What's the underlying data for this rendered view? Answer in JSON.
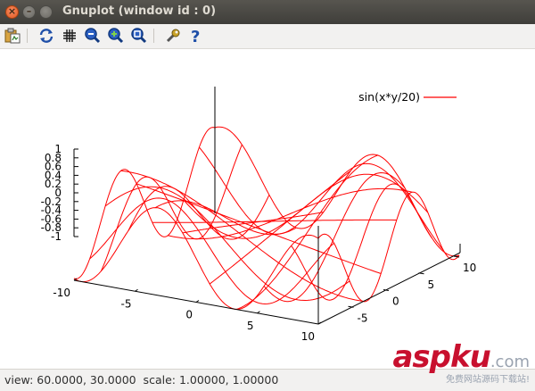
{
  "window": {
    "title": "Gnuplot (window id : 0)"
  },
  "toolbar": {
    "icons": [
      "copy-clipboard-icon",
      "replot-icon",
      "grid-icon",
      "zoom-prev-icon",
      "zoom-next-icon",
      "autoscale-icon",
      "config-icon",
      "help-icon"
    ]
  },
  "chart_data": {
    "type": "surface",
    "function": "sin(x*y/20)",
    "legend": {
      "label": "sin(x*y/20)",
      "position": "top-right",
      "color": "#ff0000"
    },
    "x_range": [
      -10,
      10
    ],
    "y_range": [
      -10,
      10
    ],
    "z_range": [
      -1,
      1
    ],
    "x_ticks": [
      "-10",
      "-5",
      "0",
      "5",
      "10"
    ],
    "y_ticks": [
      "-5",
      "0",
      "5",
      "10"
    ],
    "z_ticks": [
      "1",
      "0.8",
      "0.6",
      "0.4",
      "0.2",
      "0",
      "-0.2",
      "-0.4",
      "-0.6",
      "-0.8",
      "-1"
    ],
    "iso_samples": 10,
    "samples": 100,
    "view": {
      "rot_x": 60,
      "rot_z": 30,
      "scale": 1,
      "scale_z": 1
    },
    "line_color": "#ff0000",
    "grid": false
  },
  "status": {
    "text": "view: 60.0000, 30.0000  scale: 1.00000, 1.00000"
  },
  "watermark": {
    "main": "aspku",
    "suffix": ".com",
    "sub": "免费网站源码下载站!"
  }
}
